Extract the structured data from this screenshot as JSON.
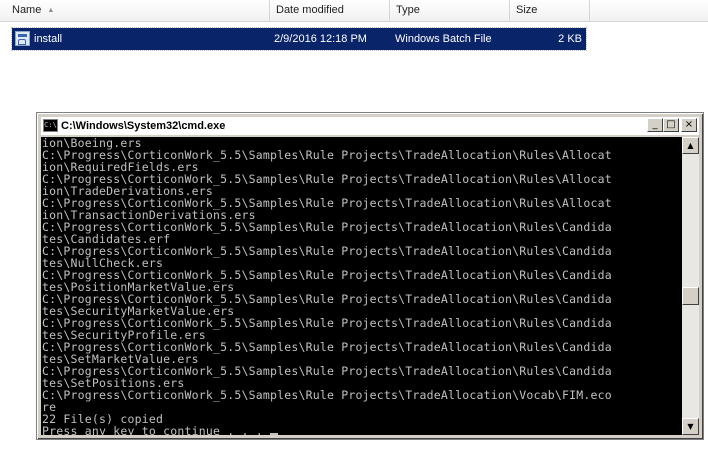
{
  "explorer": {
    "columns": {
      "name": "Name",
      "date_modified": "Date modified",
      "type": "Type",
      "size": "Size"
    },
    "sort_indicator": "ascending",
    "files": [
      {
        "name": "install",
        "date_modified": "2/9/2016 12:18 PM",
        "type": "Windows Batch File",
        "size": "2 KB",
        "icon": "batch-file-icon",
        "selected": true
      }
    ],
    "selection_color": "#0a246a"
  },
  "cmd": {
    "title": "C:\\Windows\\System32\\cmd.exe",
    "icon_text": "C:\\",
    "buttons": {
      "minimize": "_",
      "maximize": "□",
      "close": "×"
    },
    "console_background": "#000000",
    "console_foreground": "#c0c0c0",
    "console_lines": [
      "ion\\Boeing.ers",
      "C:\\Progress\\CorticonWork_5.5\\Samples\\Rule Projects\\TradeAllocation\\Rules\\Allocat",
      "ion\\RequiredFields.ers",
      "C:\\Progress\\CorticonWork_5.5\\Samples\\Rule Projects\\TradeAllocation\\Rules\\Allocat",
      "ion\\TradeDerivations.ers",
      "C:\\Progress\\CorticonWork_5.5\\Samples\\Rule Projects\\TradeAllocation\\Rules\\Allocat",
      "ion\\TransactionDerivations.ers",
      "C:\\Progress\\CorticonWork_5.5\\Samples\\Rule Projects\\TradeAllocation\\Rules\\Candida",
      "tes\\Candidates.erf",
      "C:\\Progress\\CorticonWork_5.5\\Samples\\Rule Projects\\TradeAllocation\\Rules\\Candida",
      "tes\\NullCheck.ers",
      "C:\\Progress\\CorticonWork_5.5\\Samples\\Rule Projects\\TradeAllocation\\Rules\\Candida",
      "tes\\PositionMarketValue.ers",
      "C:\\Progress\\CorticonWork_5.5\\Samples\\Rule Projects\\TradeAllocation\\Rules\\Candida",
      "tes\\SecurityMarketValue.ers",
      "C:\\Progress\\CorticonWork_5.5\\Samples\\Rule Projects\\TradeAllocation\\Rules\\Candida",
      "tes\\SecurityProfile.ers",
      "C:\\Progress\\CorticonWork_5.5\\Samples\\Rule Projects\\TradeAllocation\\Rules\\Candida",
      "tes\\SetMarketValue.ers",
      "C:\\Progress\\CorticonWork_5.5\\Samples\\Rule Projects\\TradeAllocation\\Rules\\Candida",
      "tes\\SetPositions.ers",
      "C:\\Progress\\CorticonWork_5.5\\Samples\\Rule Projects\\TradeAllocation\\Vocab\\FIM.eco",
      "re",
      "22 File(s) copied",
      "Press any key to continue . . ."
    ],
    "scrollbar": {
      "up": "▲",
      "down": "▼"
    }
  }
}
